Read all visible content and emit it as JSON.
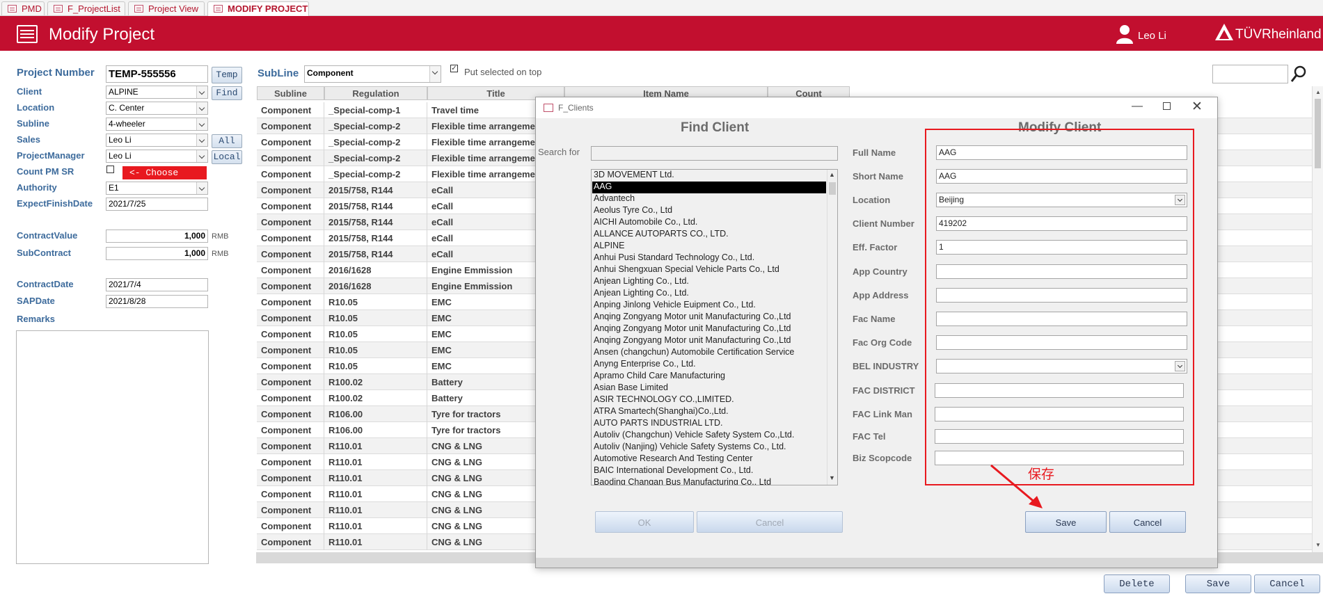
{
  "tabs": [
    {
      "label": "PMD",
      "left": 0
    },
    {
      "label": "F_ProjectList"
    },
    {
      "label": "Project View"
    },
    {
      "label": "MODIFY PROJECT"
    }
  ],
  "header": {
    "title": "Modify Project",
    "user": "Leo Li",
    "logo": "TÜVRheinland"
  },
  "form": {
    "project_number_label": "Project Number",
    "project_number": "TEMP-555556",
    "temp_btn": "Temp",
    "client_label": "Client",
    "client": "ALPINE",
    "find_btn": "Find",
    "location_label": "Location",
    "location": "C. Center",
    "subline_label": "Subline",
    "subline": "4-wheeler",
    "sales_label": "Sales",
    "sales": "Leo Li",
    "all_btn": "All",
    "pm_label": "ProjectManager",
    "pm": "Leo Li",
    "local_btn": "Local",
    "count_pm_label": "Count PM SR",
    "choose_note": "<- Choose",
    "authority_label": "Authority",
    "authority": "E1",
    "expect_label": "ExpectFinishDate",
    "expect": "2021/7/25",
    "contract_value_label": "ContractValue",
    "contract_value": "1,000",
    "rmb1": "RMB",
    "subcontract_label": "SubContract",
    "subcontract": "1,000",
    "rmb2": "RMB",
    "contract_date_label": "ContractDate",
    "contract_date": "2021/7/4",
    "sap_date_label": "SAPDate",
    "sap_date": "2021/8/28",
    "remarks_label": "Remarks",
    "remarks": ""
  },
  "grid": {
    "subline_filter_label": "SubLine",
    "subline_filter": "Component",
    "put_selected_label": "Put selected on top",
    "columns": [
      "Subline",
      "Regulation",
      "Title",
      "Item Name",
      "Count"
    ],
    "rows": [
      [
        "Component",
        "_Special-comp-1",
        "Travel time"
      ],
      [
        "Component",
        "_Special-comp-2",
        "Flexible time arrangeme"
      ],
      [
        "Component",
        "_Special-comp-2",
        "Flexible time arrangeme"
      ],
      [
        "Component",
        "_Special-comp-2",
        "Flexible time arrangeme"
      ],
      [
        "Component",
        "_Special-comp-2",
        "Flexible time arrangeme"
      ],
      [
        "Component",
        "2015/758, R144",
        "eCall"
      ],
      [
        "Component",
        "2015/758, R144",
        "eCall"
      ],
      [
        "Component",
        "2015/758, R144",
        "eCall"
      ],
      [
        "Component",
        "2015/758, R144",
        "eCall"
      ],
      [
        "Component",
        "2015/758, R144",
        "eCall"
      ],
      [
        "Component",
        "2016/1628",
        "Engine Emmission"
      ],
      [
        "Component",
        "2016/1628",
        "Engine Emmission"
      ],
      [
        "Component",
        "R10.05",
        "EMC"
      ],
      [
        "Component",
        "R10.05",
        "EMC"
      ],
      [
        "Component",
        "R10.05",
        "EMC"
      ],
      [
        "Component",
        "R10.05",
        "EMC"
      ],
      [
        "Component",
        "R10.05",
        "EMC"
      ],
      [
        "Component",
        "R100.02",
        "Battery"
      ],
      [
        "Component",
        "R100.02",
        "Battery"
      ],
      [
        "Component",
        "R106.00",
        "Tyre for tractors"
      ],
      [
        "Component",
        "R106.00",
        "Tyre for tractors"
      ],
      [
        "Component",
        "R110.01",
        "CNG & LNG"
      ],
      [
        "Component",
        "R110.01",
        "CNG & LNG"
      ],
      [
        "Component",
        "R110.01",
        "CNG & LNG"
      ],
      [
        "Component",
        "R110.01",
        "CNG & LNG"
      ],
      [
        "Component",
        "R110.01",
        "CNG & LNG"
      ],
      [
        "Component",
        "R110.01",
        "CNG & LNG"
      ],
      [
        "Component",
        "R110.01",
        "CNG & LNG"
      ]
    ]
  },
  "bottom": {
    "delete": "Delete",
    "save": "Save",
    "cancel": "Cancel"
  },
  "dialog": {
    "window_title": "F_Clients",
    "find_title": "Find Client",
    "search_label": "Search for",
    "search_value": "",
    "clients": [
      "3D MOVEMENT Ltd.",
      "AAG",
      "Advantech",
      "Aeolus Tyre Co., Ltd",
      "AICHI Automobile Co., Ltd.",
      "ALLANCE AUTOPARTS CO., LTD.",
      "ALPINE",
      "Anhui Pusi Standard Technology Co., Ltd.",
      "Anhui Shengxuan Special Vehicle Parts Co., Ltd",
      "Anjean Lighting Co., Ltd.",
      "Anjean Lighting Co., Ltd.",
      "Anping Jinlong Vehicle Euipment Co., Ltd.",
      "Anqing Zongyang Motor unit Manufacturing Co.,Ltd",
      "Anqing Zongyang Motor unit Manufacturing Co.,Ltd",
      "Anqing Zongyang Motor unit Manufacturing Co.,Ltd",
      "Ansen (changchun) Automobile Certification Service",
      "Anyng Enterprise Co., Ltd.",
      "Apramo Child Care Manufacturing",
      "Asian Base Limited",
      "ASIR TECHNOLOGY CO.,LIMITED.",
      "ATRA Smartech(Shanghai)Co.,Ltd.",
      "AUTO PARTS INDUSTRIAL LTD.",
      "Autoliv (Changchun) Vehicle Safety System Co.,Ltd.",
      "Autoliv (Nanjing) Vehicle Safety Systems Co., Ltd.",
      "Automotive Research And Testing Center",
      "BAIC International Development Co., Ltd.",
      "Baoding Changan Bus Manufacturing Co., Ltd"
    ],
    "selected_client": "AAG",
    "ok": "OK",
    "cancel_left": "Cancel",
    "modify_title": "Modify Client",
    "fields": [
      {
        "label": "Full Name",
        "value": "AAG"
      },
      {
        "label": "Short Name",
        "value": "AAG"
      },
      {
        "label": "Location",
        "value": "Beijing"
      },
      {
        "label": "Client Number",
        "value": "419202"
      },
      {
        "label": "Eff. Factor",
        "value": "1"
      },
      {
        "label": "App Country",
        "value": ""
      },
      {
        "label": "App Address",
        "value": ""
      },
      {
        "label": "Fac Name",
        "value": ""
      },
      {
        "label": "Fac Org Code",
        "value": ""
      },
      {
        "label": "BEL INDUSTRY",
        "value": ""
      },
      {
        "label": "FAC DISTRICT",
        "value": ""
      },
      {
        "label": "FAC Link Man",
        "value": ""
      },
      {
        "label": "FAC Tel",
        "value": ""
      },
      {
        "label": "Biz Scopcode",
        "value": ""
      }
    ],
    "annotation": "保存",
    "save": "Save",
    "cancel_right": "Cancel"
  },
  "colors": {
    "brand": "#c20f2f",
    "annotation": "#e8191f"
  }
}
